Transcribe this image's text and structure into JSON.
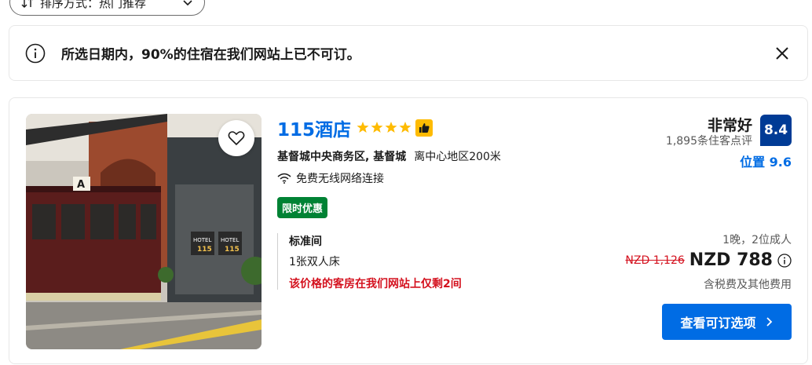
{
  "sort": {
    "label": "排序方式：热门推荐"
  },
  "banner": {
    "message": "所选日期内，90%的住宿在我们网站上已不可订。"
  },
  "hotel": {
    "name": "115酒店",
    "star_count": 4,
    "area": "基督城中央商务区, 基督城",
    "distance": "离中心地区200米",
    "amenity": "免费无线网络连接",
    "deal": "限时优惠",
    "room": {
      "name": "标准间",
      "bed": "1张双人床",
      "scarcity": "该价格的客房在我们网站上仅剩2间"
    },
    "rating": {
      "word": "非常好",
      "score": "8.4",
      "reviews": "1,895条住客点评",
      "location": "位置 9.6"
    },
    "price": {
      "stay": "1晚，2位成人",
      "old": "NZD 1,126",
      "new": "NZD 788",
      "tax_note": "含税费及其他费用"
    },
    "cta": "查看可订选项"
  },
  "colors": {
    "brand_blue": "#006ce4",
    "dark_blue": "#003b95",
    "deal_green": "#008234",
    "alert_red": "#d4111e",
    "star_yellow": "#febb02"
  }
}
